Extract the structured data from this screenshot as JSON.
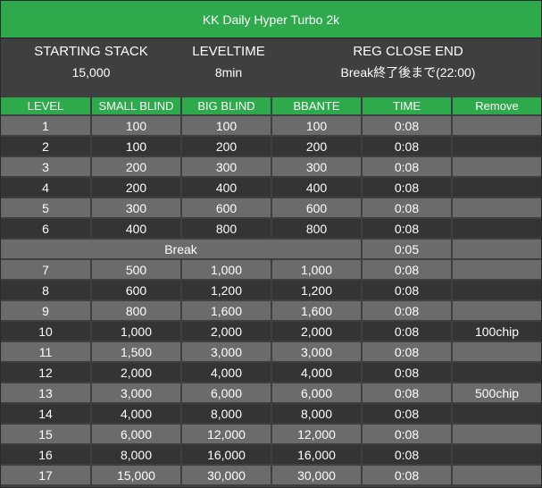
{
  "title": "KK Daily Hyper Turbo 2k",
  "info": {
    "starting_stack_label": "STARTING STACK",
    "starting_stack_value": "15,000",
    "leveltime_label": "LEVELTIME",
    "leveltime_value": "8min",
    "reg_close_label": "REG CLOSE END",
    "reg_close_value": "Break終了後まで(22:00)"
  },
  "columns": [
    "LEVEL",
    "SMALL BLIND",
    "BIG BLIND",
    "BBANTE",
    "TIME",
    "Remove"
  ],
  "rows": [
    {
      "level": "1",
      "sb": "100",
      "bb": "100",
      "ante": "100",
      "time": "0:08",
      "remove": ""
    },
    {
      "level": "2",
      "sb": "100",
      "bb": "200",
      "ante": "200",
      "time": "0:08",
      "remove": ""
    },
    {
      "level": "3",
      "sb": "200",
      "bb": "300",
      "ante": "300",
      "time": "0:08",
      "remove": ""
    },
    {
      "level": "4",
      "sb": "200",
      "bb": "400",
      "ante": "400",
      "time": "0:08",
      "remove": ""
    },
    {
      "level": "5",
      "sb": "300",
      "bb": "600",
      "ante": "600",
      "time": "0:08",
      "remove": ""
    },
    {
      "level": "6",
      "sb": "400",
      "bb": "800",
      "ante": "800",
      "time": "0:08",
      "remove": ""
    },
    {
      "break": true,
      "label": "Break",
      "time": "0:05",
      "remove": ""
    },
    {
      "level": "7",
      "sb": "500",
      "bb": "1,000",
      "ante": "1,000",
      "time": "0:08",
      "remove": ""
    },
    {
      "level": "8",
      "sb": "600",
      "bb": "1,200",
      "ante": "1,200",
      "time": "0:08",
      "remove": ""
    },
    {
      "level": "9",
      "sb": "800",
      "bb": "1,600",
      "ante": "1,600",
      "time": "0:08",
      "remove": ""
    },
    {
      "level": "10",
      "sb": "1,000",
      "bb": "2,000",
      "ante": "2,000",
      "time": "0:08",
      "remove": "100chip"
    },
    {
      "level": "11",
      "sb": "1,500",
      "bb": "3,000",
      "ante": "3,000",
      "time": "0:08",
      "remove": ""
    },
    {
      "level": "12",
      "sb": "2,000",
      "bb": "4,000",
      "ante": "4,000",
      "time": "0:08",
      "remove": ""
    },
    {
      "level": "13",
      "sb": "3,000",
      "bb": "6,000",
      "ante": "6,000",
      "time": "0:08",
      "remove": "500chip"
    },
    {
      "level": "14",
      "sb": "4,000",
      "bb": "8,000",
      "ante": "8,000",
      "time": "0:08",
      "remove": ""
    },
    {
      "level": "15",
      "sb": "6,000",
      "bb": "12,000",
      "ante": "12,000",
      "time": "0:08",
      "remove": ""
    },
    {
      "level": "16",
      "sb": "8,000",
      "bb": "16,000",
      "ante": "16,000",
      "time": "0:08",
      "remove": ""
    },
    {
      "level": "17",
      "sb": "15,000",
      "bb": "30,000",
      "ante": "30,000",
      "time": "0:08",
      "remove": ""
    }
  ],
  "colors": {
    "header_green": "#2eaa4c",
    "row_light": "#6b6b6b",
    "row_dark": "#343434",
    "background": "#3f3f3f"
  }
}
